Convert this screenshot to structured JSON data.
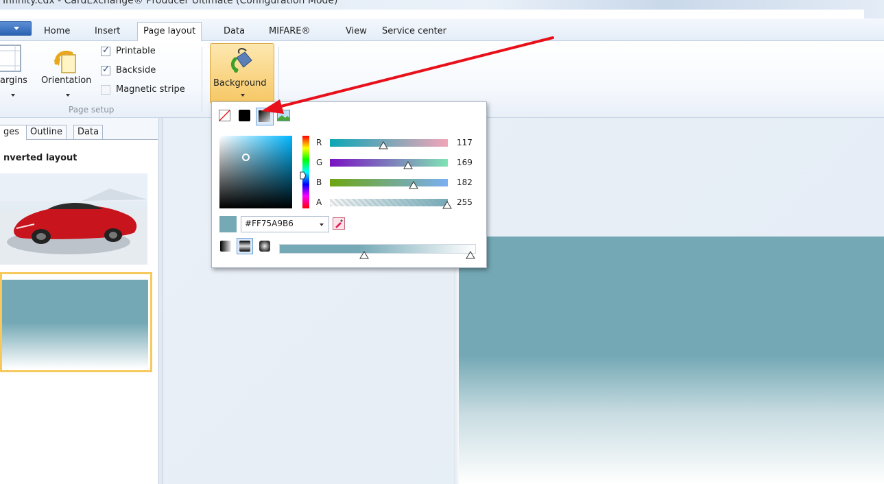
{
  "window": {
    "title": "Infinity.cdx - CardExchange® Producer Ultimate (Configuration Mode)"
  },
  "tabs": [
    {
      "label": "Home"
    },
    {
      "label": "Insert"
    },
    {
      "label": "Page layout"
    },
    {
      "label": "Data"
    },
    {
      "label": "MIFARE®"
    },
    {
      "label": "View"
    },
    {
      "label": "Service center"
    }
  ],
  "active_tab": "Page layout",
  "ribbon": {
    "margins_label": "argins",
    "orientation_label": "Orientation",
    "printable_label": "Printable",
    "printable_checked": true,
    "backside_label": "Backside",
    "backside_checked": true,
    "magnetic_label": "Magnetic stripe",
    "magnetic_checked": false,
    "group_caption": "Page setup",
    "background_label": "Background"
  },
  "panel": {
    "tabs": [
      {
        "label": "ges"
      },
      {
        "label": "Outline"
      },
      {
        "label": "Data"
      }
    ],
    "layout_title": "nverted layout"
  },
  "color_picker": {
    "fill_types": [
      "none-icon",
      "solid-icon",
      "gradient-icon",
      "image-icon"
    ],
    "selected_fill_type": "gradient",
    "channels": [
      {
        "label": "R",
        "value": "117"
      },
      {
        "label": "G",
        "value": "169"
      },
      {
        "label": "B",
        "value": "182"
      },
      {
        "label": "A",
        "value": "255"
      }
    ],
    "hex_value": "#FF75A9B6",
    "current_color": "#75a9b6",
    "gradient_types": [
      "linear-gradient-icon",
      "reflected-gradient-icon",
      "radial-gradient-icon"
    ],
    "selected_gradient_type": "reflected",
    "gradient_stop_start": 0.43,
    "gradient_stop_end": 1.0
  },
  "annotation": {
    "color": "#e8101a"
  }
}
